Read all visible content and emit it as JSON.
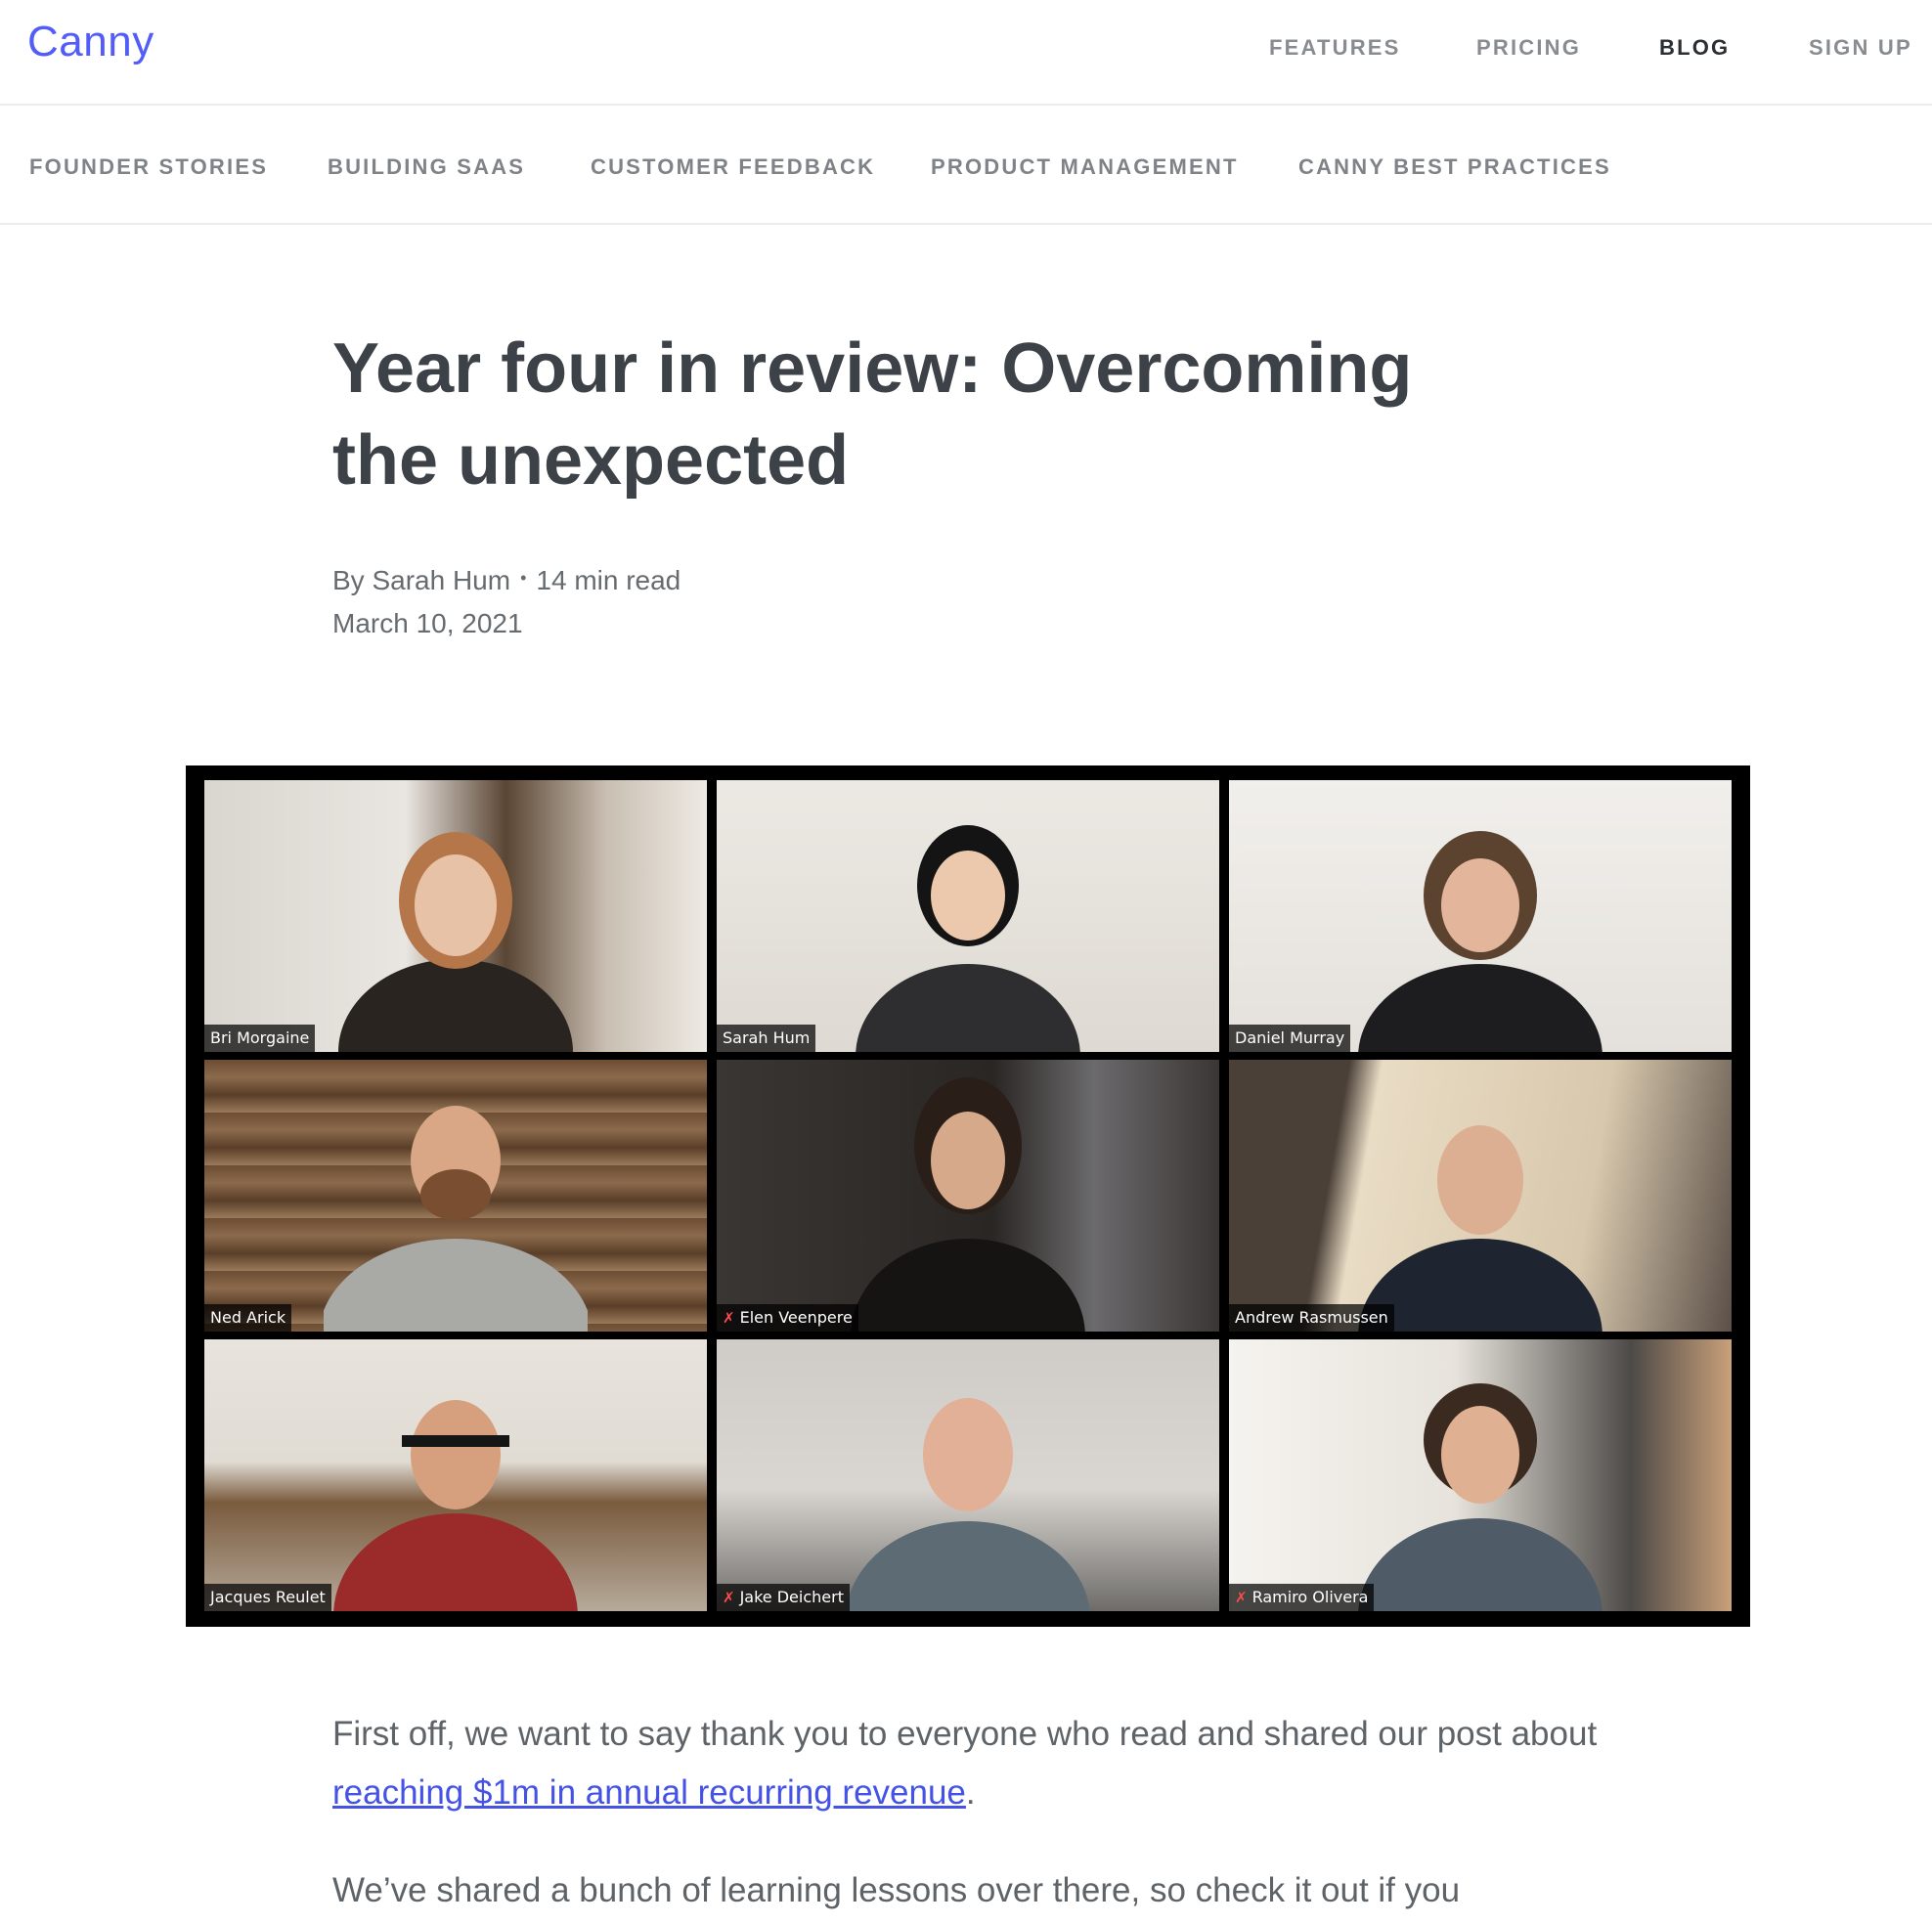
{
  "header": {
    "logo": "Canny",
    "nav": [
      {
        "label": "FEATURES"
      },
      {
        "label": "PRICING"
      },
      {
        "label": "BLOG",
        "active": true
      },
      {
        "label": "SIGN UP"
      }
    ]
  },
  "categories": [
    {
      "label": "FOUNDER STORIES"
    },
    {
      "label": "BUILDING SAAS"
    },
    {
      "label": "CUSTOMER FEEDBACK"
    },
    {
      "label": "PRODUCT MANAGEMENT"
    },
    {
      "label": "CANNY BEST PRACTICES"
    }
  ],
  "article": {
    "title": "Year four in review: Overcoming the unexpected",
    "author": "By Sarah Hum",
    "separator": "•",
    "read_time": "14 min read",
    "date": "March 10, 2021"
  },
  "hero_image": {
    "participants": [
      {
        "name": "Bri Morgaine",
        "muted": false
      },
      {
        "name": "Sarah Hum",
        "muted": false
      },
      {
        "name": "Daniel Murray",
        "muted": false
      },
      {
        "name": "Ned Arick",
        "muted": false
      },
      {
        "name": "Elen Veenpere",
        "muted": true
      },
      {
        "name": "Andrew Rasmussen",
        "muted": false
      },
      {
        "name": "Jacques Reulet",
        "muted": false
      },
      {
        "name": "Jake Deichert",
        "muted": true
      },
      {
        "name": "Ramiro Olivera",
        "muted": true
      }
    ]
  },
  "body": {
    "p1_before": "First off, we want to say thank you to everyone who read and shared our post about ",
    "p1_link": "reaching $1m in annual recurring revenue",
    "p1_after": ".",
    "p2": "We’ve shared a bunch of learning lessons over there, so check it out if you"
  },
  "colors": {
    "brand": "#525df9",
    "link": "#4452e6",
    "muted_icon": "#ff4b4b"
  }
}
